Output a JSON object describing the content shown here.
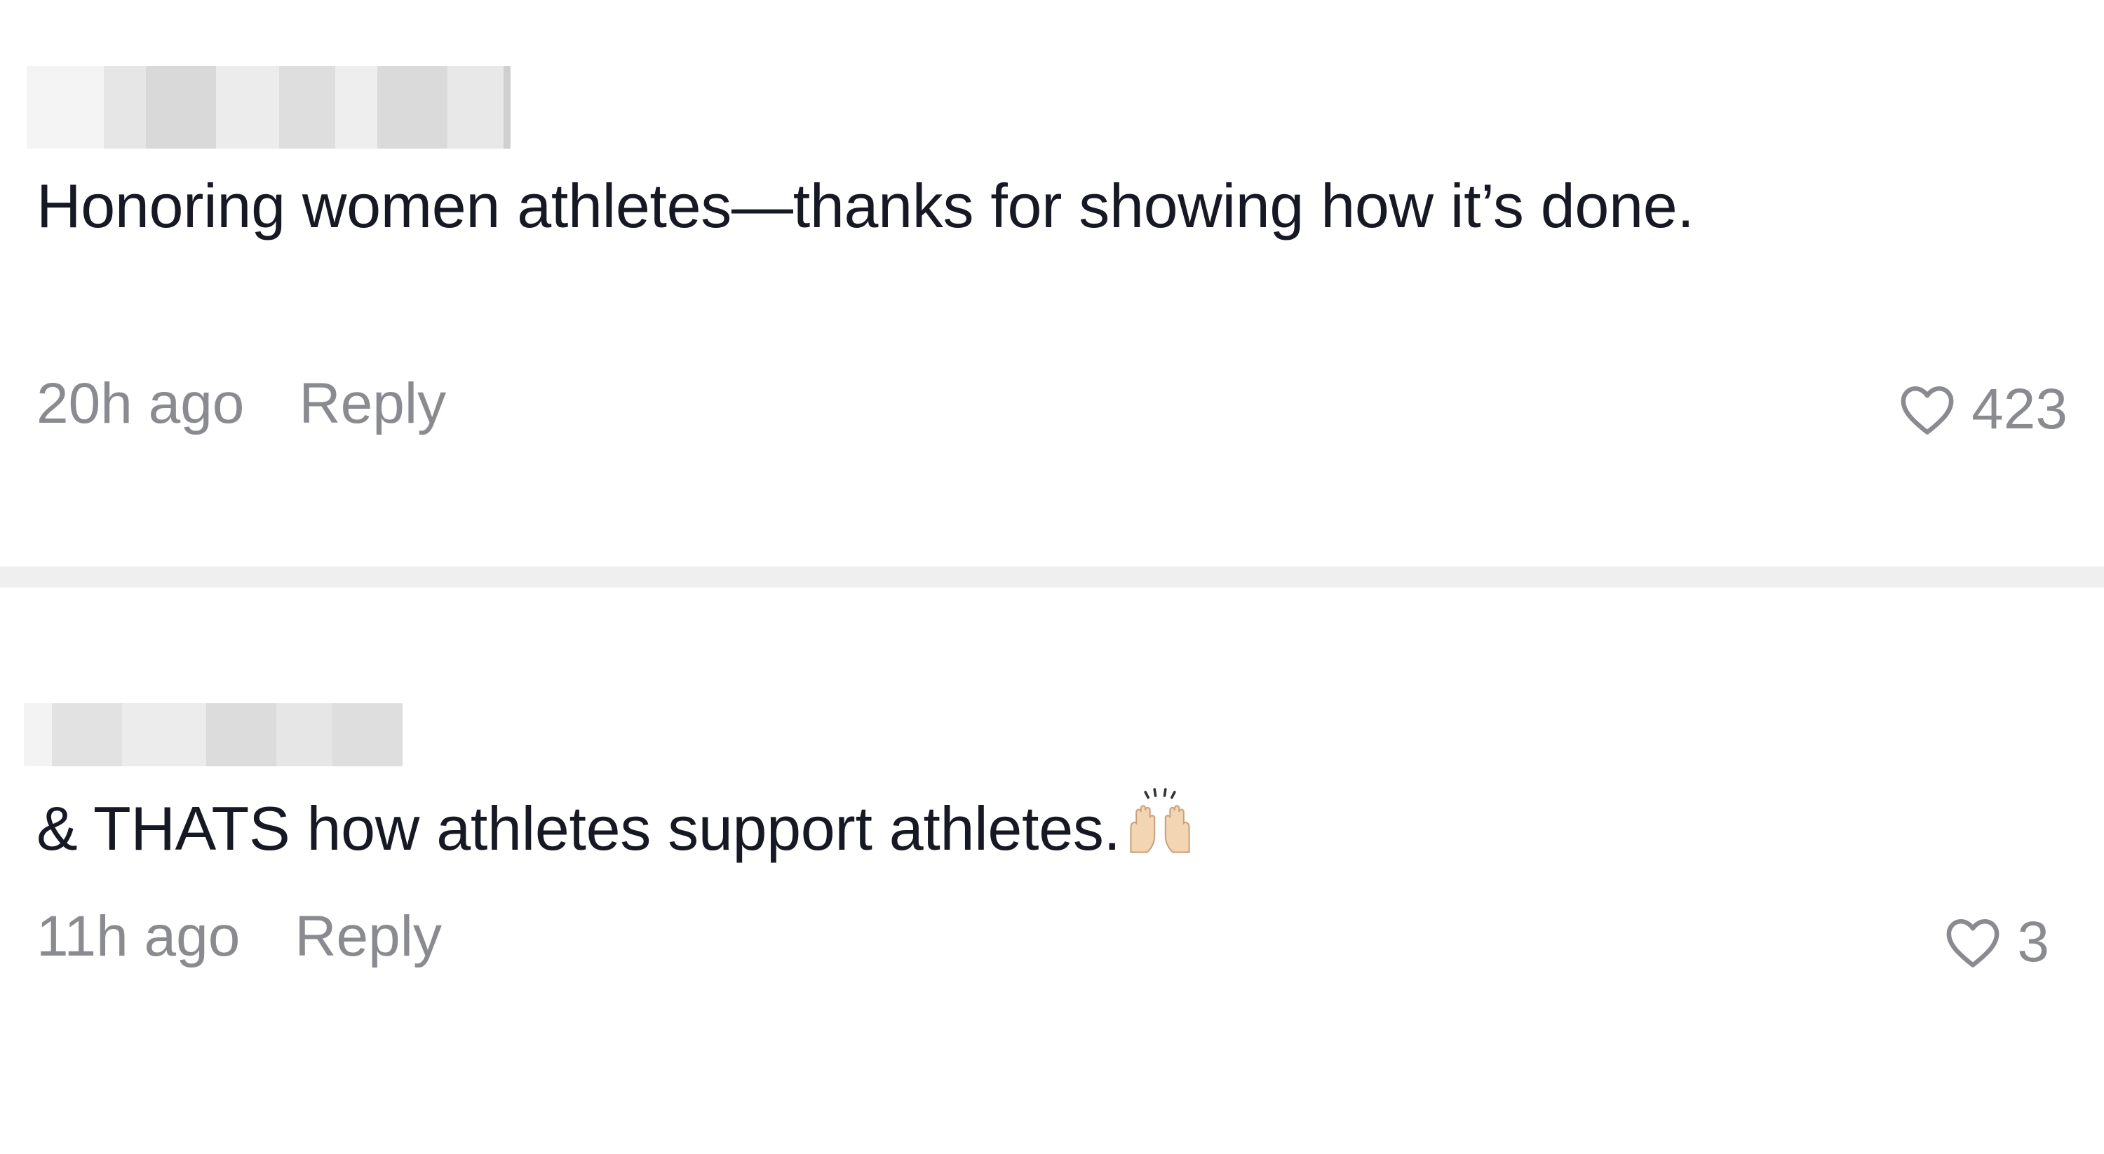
{
  "comments": [
    {
      "username": "",
      "text": "Honoring women athletes—thanks for showing how it’s done.",
      "time": "20h ago",
      "reply_label": "Reply",
      "likes": "423",
      "like_icon": "heart-outline-icon"
    },
    {
      "username": "",
      "text": "& THATS how athletes support athletes.",
      "emoji": "raising-hands-emoji",
      "time": "11h ago",
      "reply_label": "Reply",
      "likes": "3",
      "like_icon": "heart-outline-icon"
    }
  ],
  "colors": {
    "text": "#161823",
    "meta": "#8a8b91",
    "divider": "#efeff0",
    "background": "#ffffff"
  }
}
